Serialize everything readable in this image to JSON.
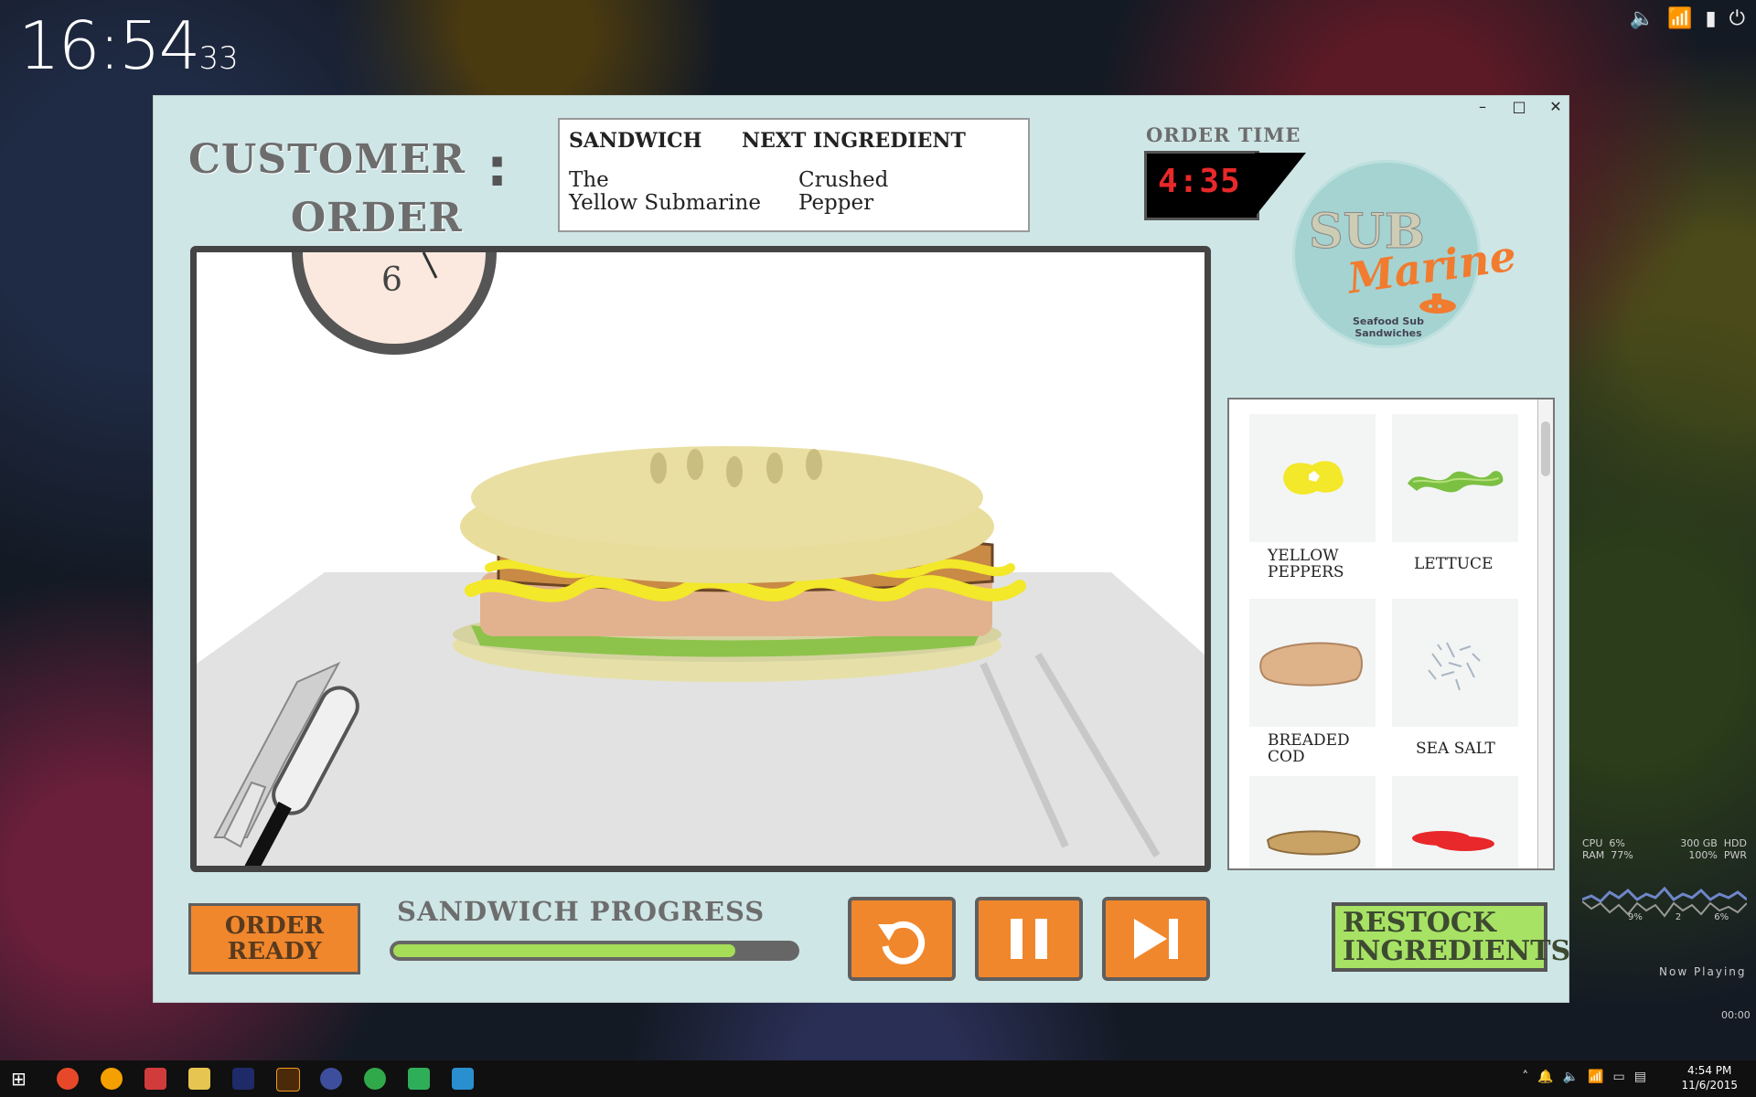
{
  "desktop_clock": {
    "hm": "16:54",
    "sec": "33"
  },
  "window": {
    "minimize": "–",
    "maximize": "□",
    "close": "✕"
  },
  "header": {
    "title_line1": "CUSTOMER",
    "title_line2": "ORDER",
    "colon": ":",
    "order_box": {
      "col1_header": "SANDWICH",
      "col2_header": "NEXT INGREDIENT",
      "sandwich_line1": "The",
      "sandwich_line2": "Yellow Submarine",
      "next_line1": "Crushed",
      "next_line2": "Pepper"
    },
    "order_time_label": "ORDER TIME",
    "order_time_value": "4:35"
  },
  "logo": {
    "line1": "SUB",
    "line2": "Marine",
    "tagline_line1": "Seafood Sub",
    "tagline_line2": "Sandwiches"
  },
  "scene": {
    "wall_clock_number": "6"
  },
  "ingredients": [
    {
      "label_line1": "YELLOW",
      "label_line2": "PEPPERS",
      "icon": "yellow-peppers-icon"
    },
    {
      "label_line1": "LETTUCE",
      "label_line2": "",
      "icon": "lettuce-icon"
    },
    {
      "label_line1": "BREADED",
      "label_line2": "COD",
      "icon": "breaded-cod-icon"
    },
    {
      "label_line1": "SEA SALT",
      "label_line2": "",
      "icon": "sea-salt-icon"
    },
    {
      "label_line1": "",
      "label_line2": "",
      "icon": "fried-fish-icon"
    },
    {
      "label_line1": "",
      "label_line2": "",
      "icon": "red-pepper-icon"
    }
  ],
  "controls": {
    "order_ready_line1": "ORDER",
    "order_ready_line2": "READY",
    "progress_label": "SANDWICH PROGRESS",
    "progress": 0.85,
    "restock_line1": "RESTOCK",
    "restock_line2": "INGREDIENTS"
  },
  "gadget": {
    "cpu_label": "CPU",
    "cpu_value": "6%",
    "ram_label": "RAM",
    "ram_value": "77%",
    "hdd_value": "300 GB",
    "hdd_label": "HDD",
    "pwr_value": "100%",
    "pwr_label": "PWR",
    "graph_left": "9%",
    "graph_mid": "2",
    "graph_right": "6%",
    "now_playing": "Now Playing",
    "np_time": "00:00"
  },
  "taskbar": {
    "time": "4:54 PM",
    "date": "11/6/2015"
  },
  "colors": {
    "accent_orange": "#f0872c",
    "restock_green": "#a7e265",
    "window_bg": "#cfe6e6",
    "timer_red": "#e8282a"
  }
}
